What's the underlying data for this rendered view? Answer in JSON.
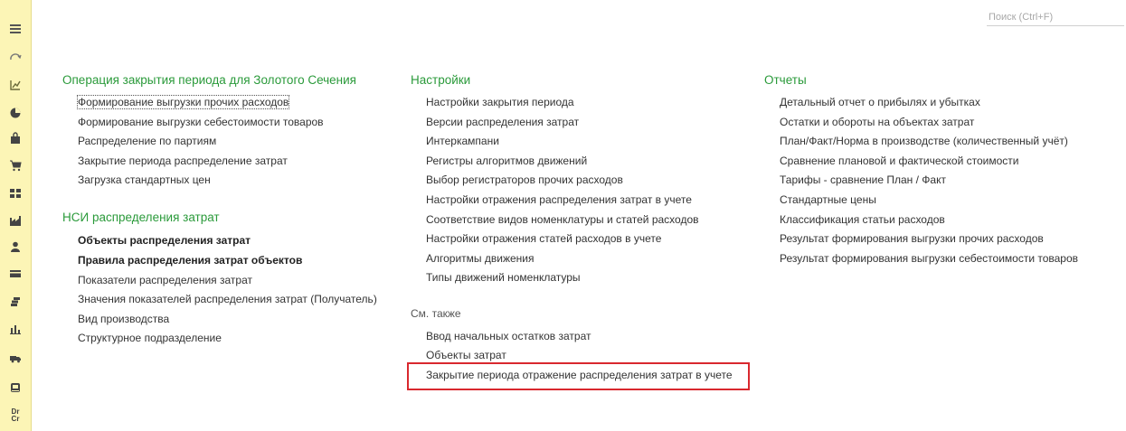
{
  "search": {
    "placeholder": "Поиск (Ctrl+F)"
  },
  "sidebar": {
    "items": [
      {
        "icon": "menu-icon"
      },
      {
        "icon": "history-icon"
      },
      {
        "icon": "chart-edit-icon"
      },
      {
        "icon": "pie-chart-icon"
      },
      {
        "icon": "bag-icon"
      },
      {
        "icon": "cart-icon"
      },
      {
        "icon": "grid-icon"
      },
      {
        "icon": "factory-icon"
      },
      {
        "icon": "person-icon"
      },
      {
        "icon": "card-icon"
      },
      {
        "icon": "coins-icon"
      },
      {
        "icon": "bar-chart-icon"
      },
      {
        "icon": "truck-icon"
      },
      {
        "icon": "bank-icon"
      },
      {
        "icon": "debit-credit-icon",
        "label_dr": "Dr",
        "label_cr": "Cr"
      }
    ],
    "highlight_color": "#f6e77c"
  },
  "col1": {
    "section1": {
      "title": "Операция закрытия периода для Золотого Сечения",
      "links": [
        "Формирование выгрузки прочих расходов",
        "Формирование выгрузки себестоимости товаров",
        "Распределение по партиям",
        "Закрытие периода распределение затрат",
        "Загрузка стандартных цен"
      ]
    },
    "section2": {
      "title": "НСИ распределения затрат",
      "links": [
        "Объекты распределения затрат",
        "Правила распределения затрат объектов",
        "Показатели распределения затрат",
        "Значения показателей распределения затрат (Получатель)",
        "Вид производства",
        "Структурное подразделение"
      ]
    }
  },
  "col2": {
    "title": "Настройки",
    "links": [
      "Настройки закрытия периода",
      "Версии распределения затрат",
      "Интеркампани",
      "Регистры алгоритмов движений",
      "Выбор регистраторов прочих расходов",
      "Настройки отражения распределения затрат в учете",
      "Соответствие видов номенклатуры и статей расходов",
      "Настройки отражения статей расходов в учете",
      "Алгоритмы движения",
      "Типы движений номенклатуры"
    ],
    "see_also": {
      "title": "См. также",
      "links": [
        "Ввод начальных остатков затрат",
        "Объекты затрат",
        "Закрытие периода отражение распределения затрат в учете"
      ]
    }
  },
  "col3": {
    "title": "Отчеты",
    "links": [
      "Детальный отчет о прибылях и убытках",
      "Остатки и обороты на объектах затрат",
      "План/Факт/Норма в производстве (количественный учёт)",
      "Сравнение плановой и фактической стоимости",
      "Тарифы - сравнение План / Факт",
      "Стандартные цены",
      "Классификация статьи расходов",
      "Результат формирования выгрузки прочих расходов",
      "Результат формирования выгрузки себестоимости товаров"
    ]
  },
  "colors": {
    "section_title": "#2a9a3a",
    "sidebar_bg": "#fcf5b6",
    "callout_border": "#d9282e"
  }
}
